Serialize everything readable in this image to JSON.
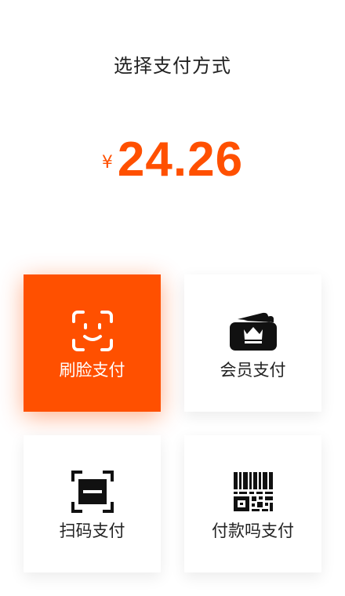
{
  "header": {
    "title": "选择支付方式"
  },
  "payment": {
    "currency_symbol": "¥",
    "amount": "24.26"
  },
  "methods": [
    {
      "label": "刷脸支付",
      "icon": "face-scan-icon",
      "selected": true
    },
    {
      "label": "会员支付",
      "icon": "member-wallet-icon",
      "selected": false
    },
    {
      "label": "扫码支付",
      "icon": "scan-code-icon",
      "selected": false
    },
    {
      "label": "付款吗支付",
      "icon": "qr-code-icon",
      "selected": false
    }
  ],
  "colors": {
    "accent": "#ff5000",
    "text": "#222222",
    "background": "#ffffff"
  }
}
